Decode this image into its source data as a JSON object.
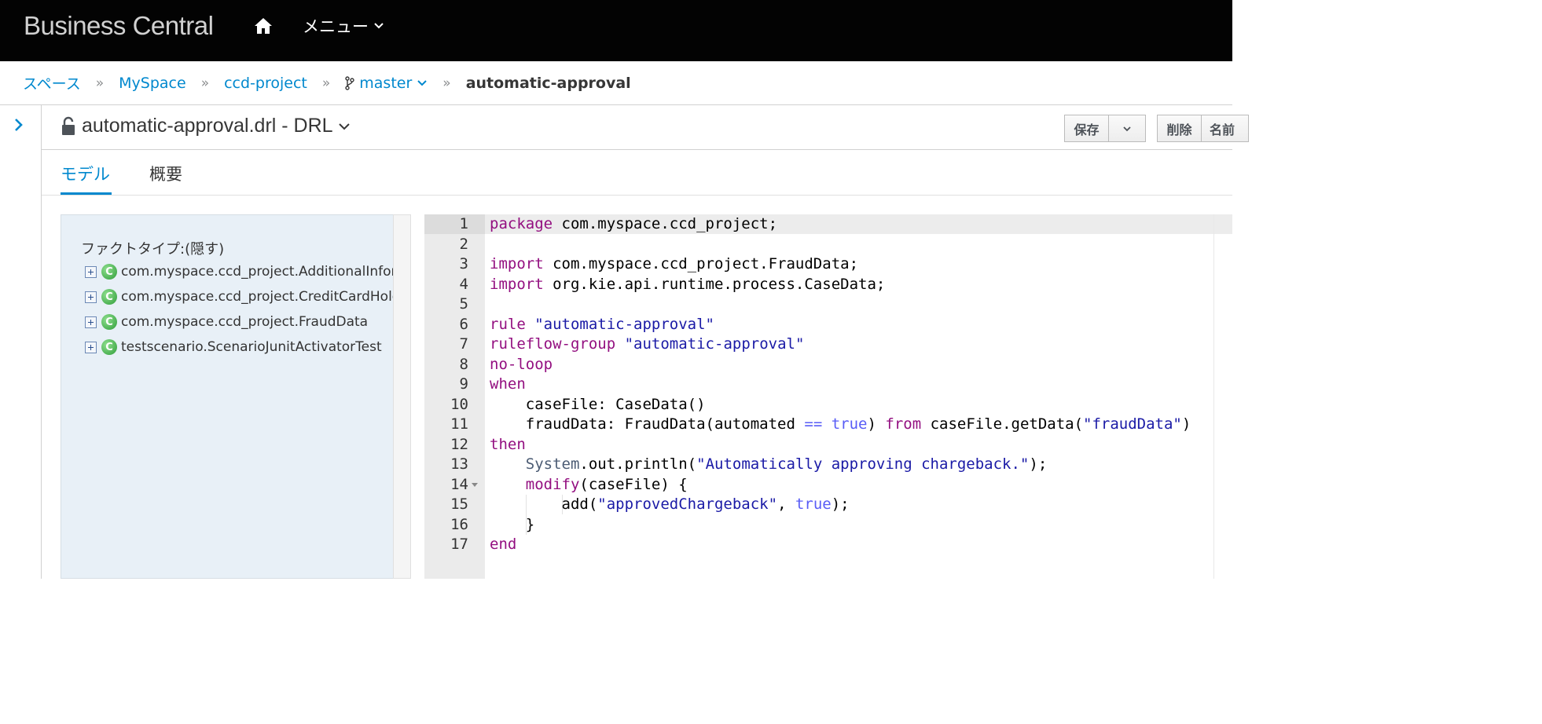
{
  "header": {
    "brand": "Business Central",
    "home_icon": "home-icon",
    "menu_label": "メニュー"
  },
  "breadcrumb": {
    "items": [
      "スペース",
      "MySpace",
      "ccd-project"
    ],
    "branch": "master",
    "current": "automatic-approval"
  },
  "editor": {
    "title": "automatic-approval.drl - DRL",
    "buttons": {
      "save": "保存",
      "delete": "削除",
      "rename": "名前"
    },
    "tabs": [
      "モデル",
      "概要"
    ]
  },
  "facts": {
    "header_label": "ファクトタイプ:",
    "header_toggle": "(隠す)",
    "items": [
      "com.myspace.ccd_project.AdditionalInformation",
      "com.myspace.ccd_project.CreditCardHolder",
      "com.myspace.ccd_project.FraudData",
      "testscenario.ScenarioJunitActivatorTest"
    ]
  },
  "code": {
    "line_numbers": [
      "1",
      "2",
      "3",
      "4",
      "5",
      "6",
      "7",
      "8",
      "9",
      "10",
      "11",
      "12",
      "13",
      "14",
      "15",
      "16",
      "17"
    ],
    "lines": [
      "package com.myspace.ccd_project;",
      "",
      "import com.myspace.ccd_project.FraudData;",
      "import org.kie.api.runtime.process.CaseData;",
      "",
      "rule \"automatic-approval\"",
      "ruleflow-group \"automatic-approval\"",
      "no-loop",
      "when",
      "    $caseFile: CaseData()",
      "    $fraudData: FraudData(automated == true) from $caseFile.getData(\"fraudData\")",
      "then",
      "    System.out.println(\"Automatically approving chargeback.\");",
      "    modify($caseFile) {",
      "        add(\"approvedChargeback\", true);",
      "    }",
      "end"
    ]
  },
  "colors": {
    "accent": "#0088ce",
    "masthead": "#030303",
    "keyword": "#930f80",
    "string": "#1a1aa6"
  }
}
